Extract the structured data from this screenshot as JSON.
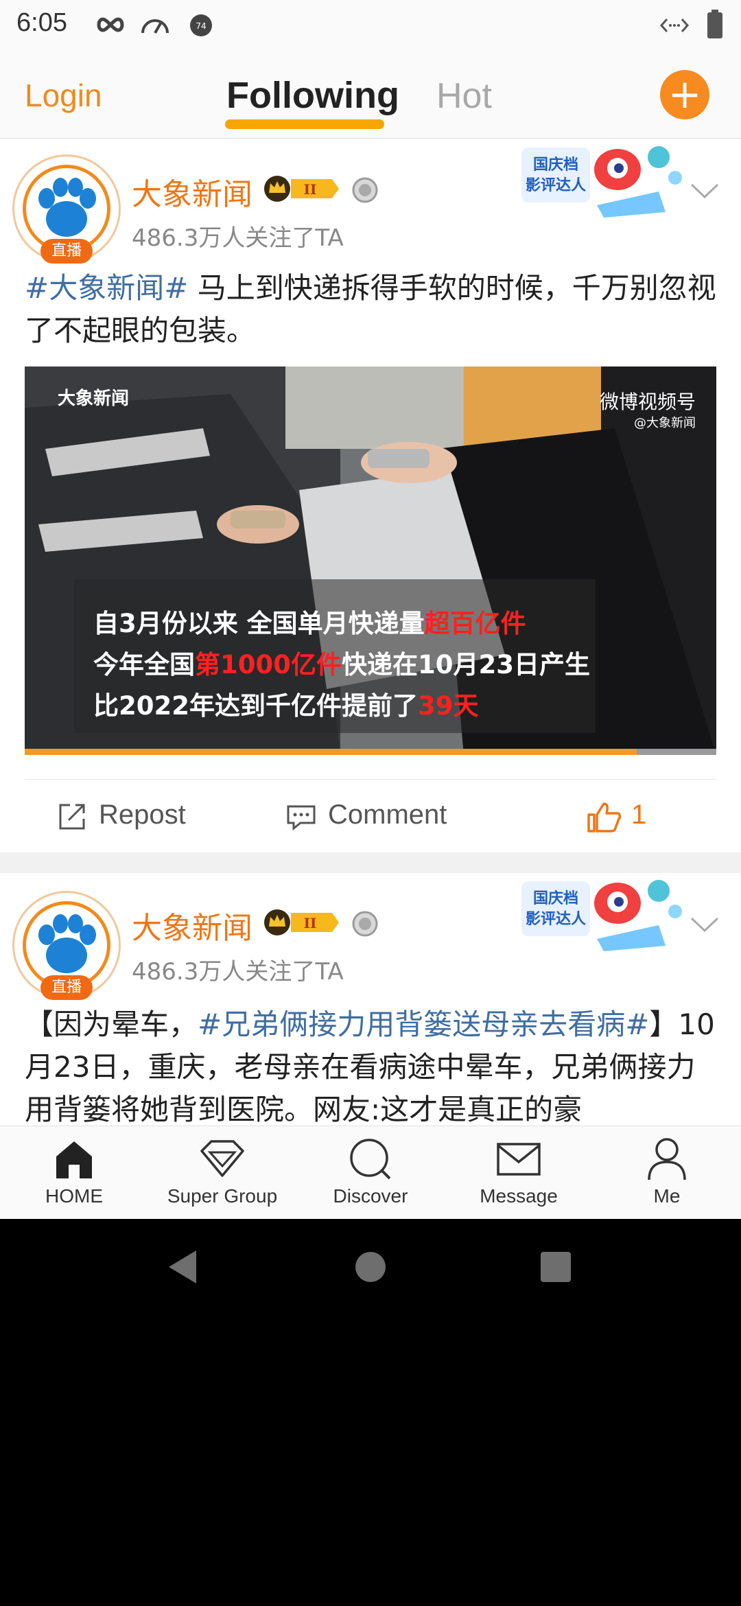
{
  "status_bar": {
    "time": "6:05"
  },
  "top_nav": {
    "login": "Login",
    "tab_following": "Following",
    "tab_hot": "Hot",
    "plus": "+"
  },
  "posts": [
    {
      "author": "大象新闻",
      "vip_level": "II",
      "followers": "486.3万人关注了TA",
      "live_badge": "直播",
      "promo_text": [
        "国庆档",
        "影评达人"
      ],
      "hashtag": "#大象新闻#",
      "text": " 马上到快递拆得手软的时候，千万别忽视了不起眼的包装。",
      "video": {
        "watermark_left": "大象新闻",
        "watermark_right": "微博视频号",
        "watermark_right_sub": "@大象新闻",
        "caption_lines": [
          {
            "a": "自3月份以来 全国单月快递量",
            "red": "超百亿件",
            "b": ""
          },
          {
            "a": "今年全国",
            "red": "第1000亿件",
            "b": "快递在10月23日产生"
          },
          {
            "a": "比2022年达到千亿件提前了",
            "red": "39天",
            "b": ""
          }
        ],
        "progress": 0.885
      },
      "actions": {
        "repost": "Repost",
        "comment": "Comment",
        "likes": "1"
      }
    },
    {
      "author": "大象新闻",
      "vip_level": "II",
      "followers": "486.3万人关注了TA",
      "live_badge": "直播",
      "promo_text": [
        "国庆档",
        "影评达人"
      ],
      "text_prefix": "【因为晕车，",
      "hashtag": "#兄弟俩接力用背篓送母亲去看病#",
      "text_suffix": "】10月23日，重庆，老母亲在看病途中晕车，兄弟俩接力用背篓将她背到医院。网友:这才是真正的豪"
    }
  ],
  "tab_bar": {
    "items": [
      {
        "label": "HOME",
        "icon": "home-icon"
      },
      {
        "label": "Super Group",
        "icon": "diamond-icon"
      },
      {
        "label": "Discover",
        "icon": "search-icon"
      },
      {
        "label": "Message",
        "icon": "mail-icon"
      },
      {
        "label": "Me",
        "icon": "person-icon"
      }
    ]
  },
  "colors": {
    "accent": "#f08a1b",
    "hashtag": "#3f6ea3",
    "highlight_red": "#ff2020"
  }
}
